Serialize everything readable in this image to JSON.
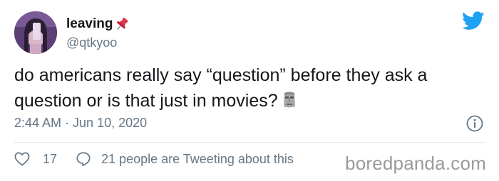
{
  "user": {
    "display_name": "leaving",
    "handle": "@qtkyoo",
    "avatar": "avatar-photo"
  },
  "tweet": {
    "text": "do americans really say “question” before they ask a question or is that just in movies?",
    "emoji": "moai-icon",
    "time": "2:44 AM",
    "separator": " · ",
    "date": "Jun 10, 2020"
  },
  "actions": {
    "like_count": "17",
    "tweeting_text": "21 people are Tweeting about this"
  },
  "watermark": "boredpanda.com",
  "colors": {
    "twitter_blue": "#1da1f2",
    "text_primary": "#14171a",
    "text_secondary": "#657786",
    "pin_red": "#e0324b",
    "divider": "#e1e8ed"
  }
}
